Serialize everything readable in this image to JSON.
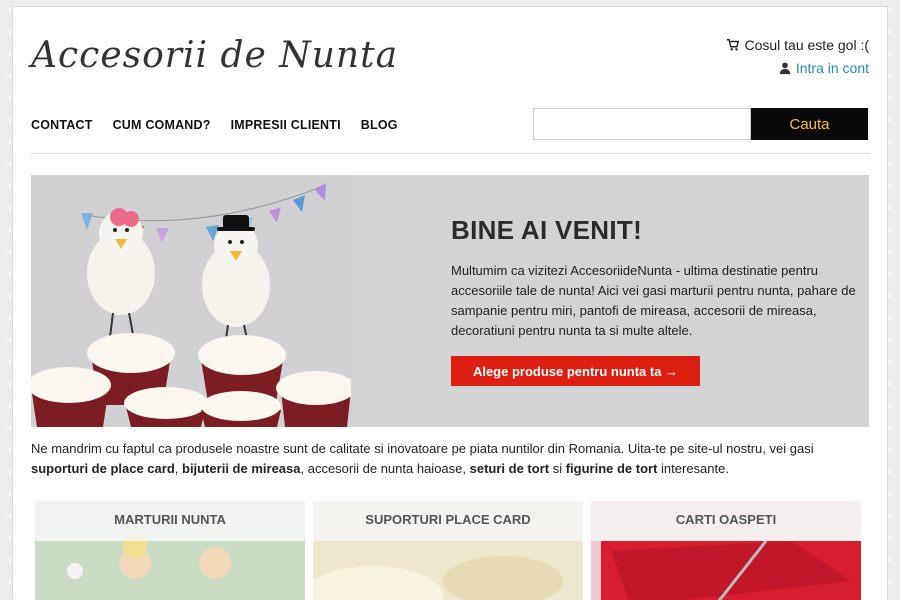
{
  "header": {
    "logo": "Accesorii de Nunta",
    "cart_text": "Cosul tau este gol :(",
    "account_link": "Intra in cont"
  },
  "nav": {
    "items": [
      "CONTACT",
      "CUM COMAND?",
      "IMPRESII CLIENTI",
      "BLOG"
    ]
  },
  "search": {
    "value": "",
    "placeholder": "",
    "button": "Cauta"
  },
  "hero": {
    "title": "BINE AI VENIT!",
    "text": "Multumim ca vizitezi AccesoriideNunta - ultima destinatie pentru accesoriile tale de nunta! Aici vei gasi marturii pentru nunta, pahare de sampanie pentru miri, pantofi de mireasa, accesorii de mireasa, decoratiuni pentru nunta ta si multe altele.",
    "button": "Alege produse pentru nunta ta →"
  },
  "intro": {
    "part1": "Ne mandrim cu faptul ca produsele noastre sunt de calitate si inovatoare pe piata nuntilor din Romania. Uita-te pe site-ul nostru, vei gasi ",
    "bold1": "suporturi de place card",
    "sep1": ", ",
    "bold2": "bijuterii de mireasa",
    "part2": ", accesorii de nunta haioase, ",
    "bold3": "seturi de tort",
    "part3": " si ",
    "bold4": "figurine de tort",
    "part4": " interesante."
  },
  "categories": [
    {
      "label": "MARTURII NUNTA"
    },
    {
      "label": "SUPORTURI PLACE CARD"
    },
    {
      "label": "CARTI OASPETI"
    }
  ],
  "colors": {
    "accent_red": "#dc1f10",
    "link_blue": "#1e88c8",
    "search_button_bg": "#0a0a0a",
    "search_button_text": "#f0c040"
  }
}
